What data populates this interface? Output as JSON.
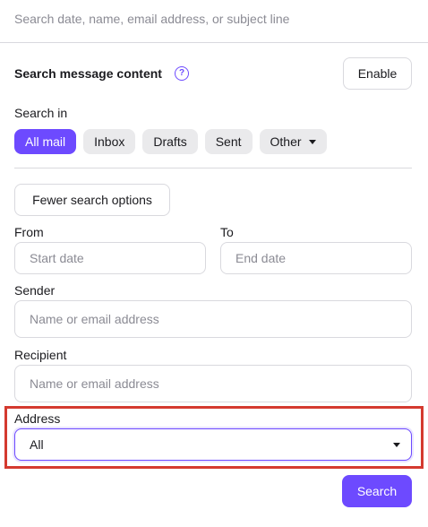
{
  "search": {
    "placeholder": "Search date, name, email address, or subject line"
  },
  "message_content": {
    "title": "Search message content",
    "help_icon": "?",
    "enable_label": "Enable"
  },
  "search_in": {
    "label": "Search in",
    "options": [
      "All mail",
      "Inbox",
      "Drafts",
      "Sent",
      "Other"
    ],
    "selected": "All mail"
  },
  "fewer_options_label": "Fewer search options",
  "from": {
    "label": "From",
    "placeholder": "Start date"
  },
  "to": {
    "label": "To",
    "placeholder": "End date"
  },
  "sender": {
    "label": "Sender",
    "placeholder": "Name or email address"
  },
  "recipient": {
    "label": "Recipient",
    "placeholder": "Name or email address"
  },
  "address": {
    "label": "Address",
    "value": "All"
  },
  "submit_label": "Search",
  "colors": {
    "accent": "#6d4aff",
    "highlight": "#d43a2f"
  },
  "icons": {
    "help": "question-circle-icon",
    "dropdown": "caret-down-icon"
  }
}
